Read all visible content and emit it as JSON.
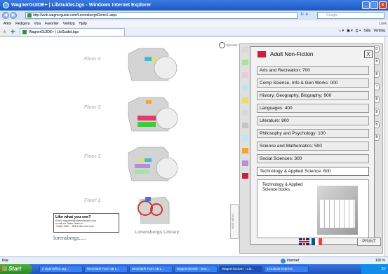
{
  "window": {
    "title": "WagnerGUIDE+ | LibGuideLbgs - Windows Internet Explorer"
  },
  "address": {
    "url": "http://web.wagnerguide.com/LorensbergsDemo1.aspx",
    "search_placeholder": "Google"
  },
  "menu": {
    "items": [
      "Arkiv",
      "Redigera",
      "Visa",
      "Favoriter",
      "Verktyg",
      "Hjälp"
    ],
    "links_label": "Länk"
  },
  "tabs": [
    {
      "label": "WagnerGUIDE+ | LibGuideLbgs"
    }
  ],
  "tools": {
    "page_label": "Sida",
    "tools_label": "Verktyg"
  },
  "map": {
    "floors": [
      "Floor 4",
      "Floor 3",
      "Floor 2",
      "Floor 1"
    ],
    "right_click_hint": "right click",
    "library_name": "Lorensbergs Library",
    "logo": "lorensbergs.....",
    "ad": {
      "heading": "Like what you see?",
      "lines": [
        "Email: wagnerel@wicaredesigns.com",
        "or call our Sales Team on",
        "+44(0) 1952 ... 508 to find out more"
      ]
    }
  },
  "side_menu": {
    "hide_label": "HIDE MENU",
    "strip_colors": [
      "#d8d8d8",
      "#a6e2a0",
      "#f2c6d4",
      "#bde6ee",
      "#e8e060",
      "#d8d8d8",
      "#c4c4c4",
      "#bfe8f4",
      "#f5a623",
      "#b48fd8",
      "#d01c3e"
    ]
  },
  "popup": {
    "title": "Adult Non-Fiction",
    "swatch_color": "#d01c3e",
    "close_label": "X",
    "categories": [
      "Arts and Recreation: 700",
      "Comp Science, Info & Gen Works: 000",
      "History, Geography, Biography: 900",
      "Languages: 400",
      "Literature: 800",
      "Philosophy and Psychology: 100",
      "Science and Mathematics: 500",
      "Social Sciences: 300",
      "Technology & Applied Science: 600"
    ],
    "selected_index": 8,
    "description": "Technology & Applied Science books."
  },
  "footer": {
    "print_label": "PRINT"
  },
  "status": {
    "left": "Klar",
    "zone": "Internet",
    "zoom": "100 %"
  },
  "taskbar": {
    "start_label": "Start",
    "items": [
      "2 OpenOffice.org...",
      "WAGNER Form 4B L...",
      "WAGNER Form 4B L...",
      "WagnerGUIDE - Goo...",
      "WagnerGUIDE+ | Lib...",
      "3 Outlook Express"
    ],
    "active_index": 4,
    "tray": "SV"
  }
}
